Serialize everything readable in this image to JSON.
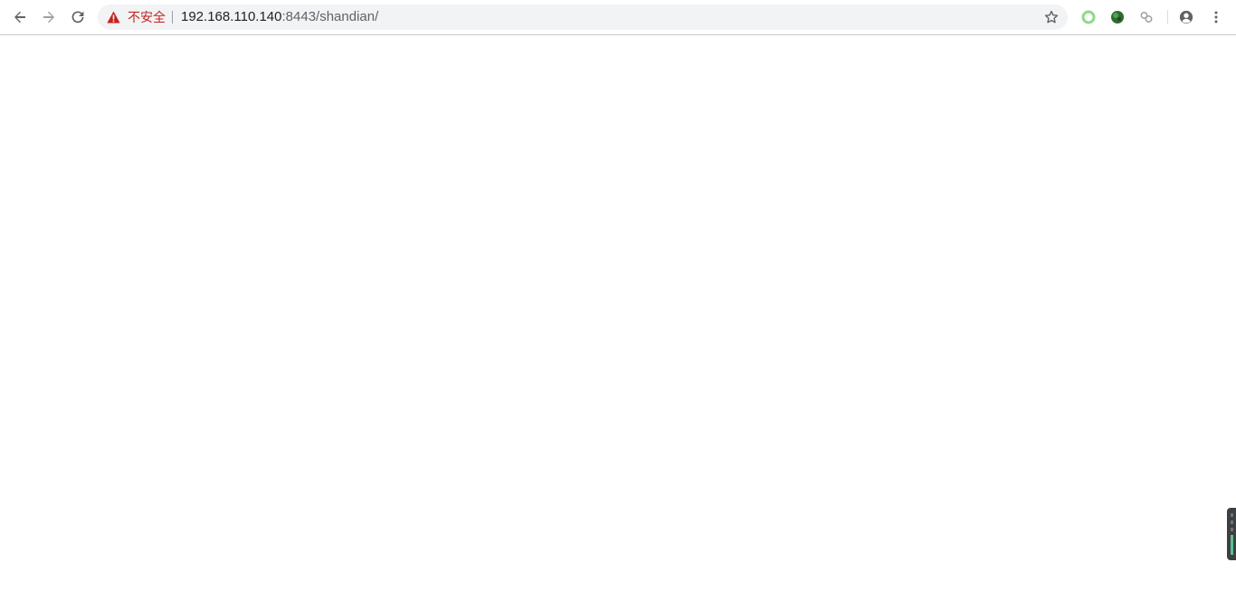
{
  "toolbar": {
    "security_label": "不安全",
    "url_host": "192.168.110.140",
    "url_rest": ":8443/shandian/"
  },
  "icons": {
    "back": "back-arrow-icon",
    "forward": "forward-arrow-icon",
    "reload": "reload-icon",
    "warning": "warning-triangle-icon",
    "bookmark": "star-icon",
    "extension_1": "green-ring-icon",
    "extension_2": "green-sphere-icon",
    "extension_3": "link-chain-icon",
    "profile": "account-circle-icon",
    "menu": "kebab-menu-icon"
  },
  "colors": {
    "security_warning": "#c5221f",
    "omnibox_bg": "#f1f3f4",
    "url_host": "#202124",
    "url_rest": "#5f6368"
  }
}
